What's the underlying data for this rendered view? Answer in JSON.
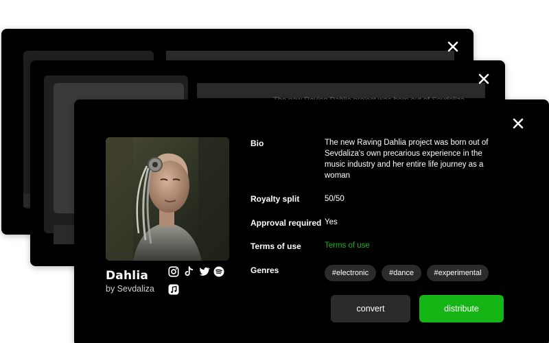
{
  "colors": {
    "background": "#ffffff",
    "card": "#000000",
    "accent_green": "#14b514",
    "link_green": "#1bb21b",
    "chip": "#2b2b2b",
    "secondary_button": "#2b2b2b"
  },
  "back_card_2": {
    "ghost_text": "The new Raving Dahlia project was born out of Sevdaliza"
  },
  "release": {
    "title": "Dahlia",
    "artist_line": "by Sevdaliza",
    "social_icons": [
      "instagram-icon",
      "tiktok-icon",
      "twitter-icon",
      "spotify-icon",
      "apple-music-icon"
    ]
  },
  "details": {
    "bio_label": "Bio",
    "bio_value": "The new Raving Dahlia project was born out of Sevdaliza's own precarious experience in the music industry and her entire life journey as a woman",
    "royalty_label": "Royalty split",
    "royalty_value": "50/50",
    "approval_label": "Approval required",
    "approval_value": "Yes",
    "terms_label": "Terms of use",
    "terms_value": "Terms of use",
    "genres_label": "Genres",
    "genres": [
      "#electronic",
      "#dance",
      "#experimental"
    ]
  },
  "actions": {
    "convert_label": "convert",
    "distribute_label": "distribute"
  }
}
